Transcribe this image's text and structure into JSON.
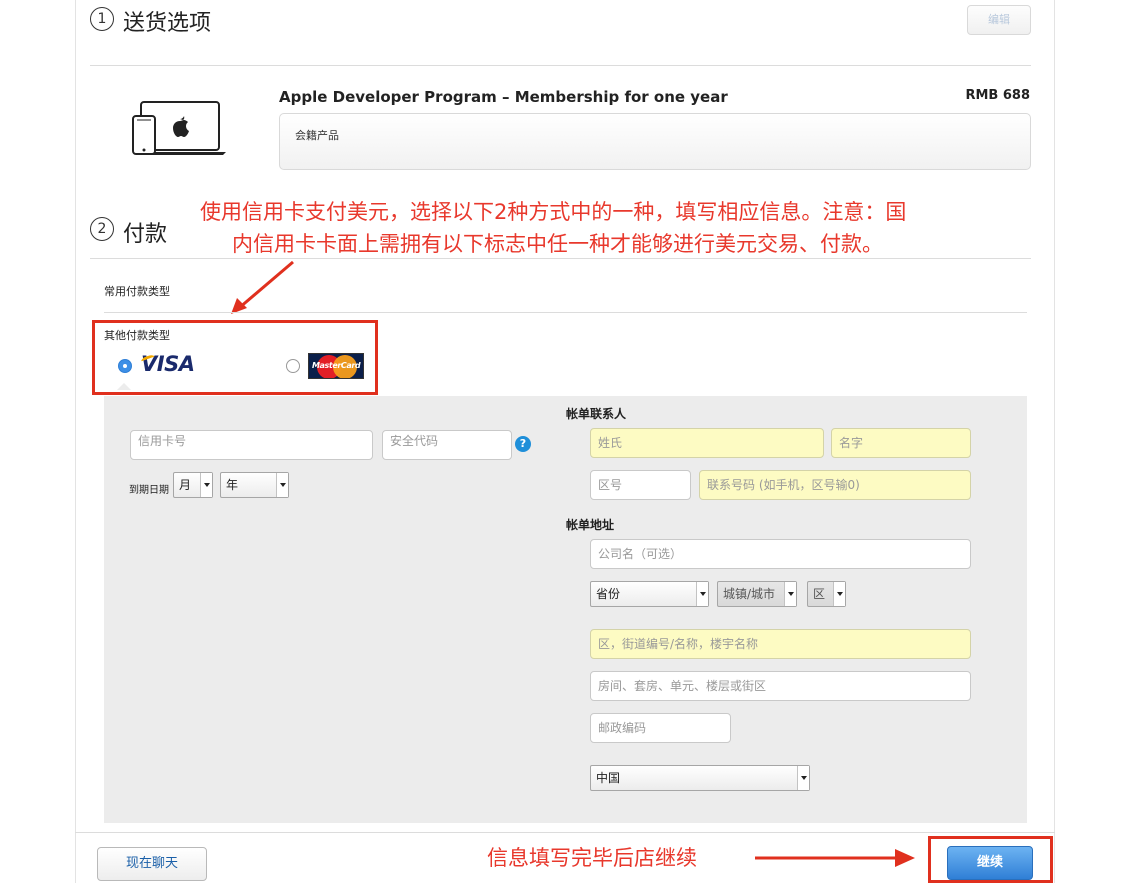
{
  "step1": {
    "number": "1",
    "title": "送货选项",
    "edit_label": "编辑"
  },
  "product": {
    "name": "Apple Developer Program – Membership for one year",
    "price": "RMB 688",
    "note": "会籍产品"
  },
  "step2": {
    "number": "2",
    "title": "付款"
  },
  "annotation_top": {
    "line1": "使用信用卡支付美元，选择以下2种方式中的一种，填写相应信息。注意：国",
    "line2": "内信用卡卡面上需拥有以下标志中任一种才能够进行美元交易、付款。"
  },
  "payment": {
    "common_label": "常用付款类型",
    "other_label": "其他付款类型",
    "options": [
      {
        "name": "VISA",
        "selected": true
      },
      {
        "name": "MasterCard",
        "selected": false
      }
    ]
  },
  "card": {
    "number_placeholder": "信用卡号",
    "cvv_placeholder": "安全代码",
    "help_icon": "?",
    "expiry_label": "到期日期",
    "month_value": "月",
    "year_value": "年"
  },
  "billing_contact": {
    "label": "帐单联系人",
    "last_name": "姓氏",
    "first_name": "名字",
    "area_code": "区号",
    "phone": "联系号码 (如手机，区号输0)"
  },
  "billing_address": {
    "label": "帐单地址",
    "company": "公司名（可选）",
    "province": "省份",
    "city": "城镇/城市",
    "district": "区",
    "street": "区，街道编号/名称，楼宇名称",
    "room": "房间、套房、单元、楼层或街区",
    "postcode": "邮政编码",
    "country": "中国"
  },
  "footer": {
    "chat_label": "现在聊天",
    "continue_label": "继续"
  },
  "annotation_bottom": "信息填写完毕后店继续",
  "colors": {
    "annotation": "#e0301e",
    "accent": "#2f7fd6",
    "highlight_field": "#fdfbc3"
  }
}
